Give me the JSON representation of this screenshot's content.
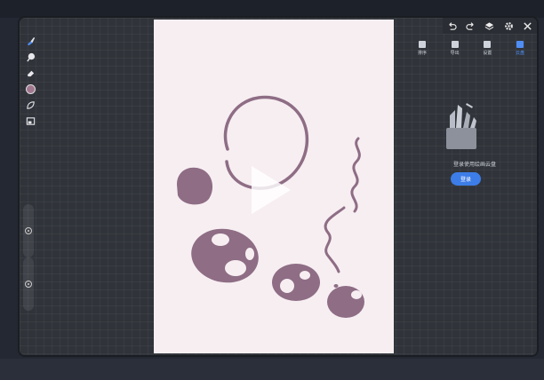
{
  "top_toolbar": {
    "undo_icon": "undo-icon",
    "redo_icon": "redo-icon",
    "layers_icon": "layers-icon",
    "settings_icon": "gear-icon",
    "close_icon": "close-icon"
  },
  "side_panel": {
    "tabs": [
      {
        "label": "排序",
        "icon": "sort-icon"
      },
      {
        "label": "导出",
        "icon": "export-icon"
      },
      {
        "label": "设置",
        "icon": "settings-icon"
      },
      {
        "label": "云盘",
        "icon": "cloud-icon"
      }
    ],
    "cloud_prompt": "登录使用绘画云盘",
    "login_button": "登录"
  },
  "left_toolbar": {
    "tools": [
      "brush-icon",
      "smudge-icon",
      "eraser-icon",
      "color-icon",
      "leaf-icon",
      "layers-thumb-icon"
    ],
    "current_color": "#a1768f"
  },
  "colors": {
    "accent": "#3d7de8",
    "ink": "#8e6d85",
    "canvas": "#f7eef1"
  }
}
